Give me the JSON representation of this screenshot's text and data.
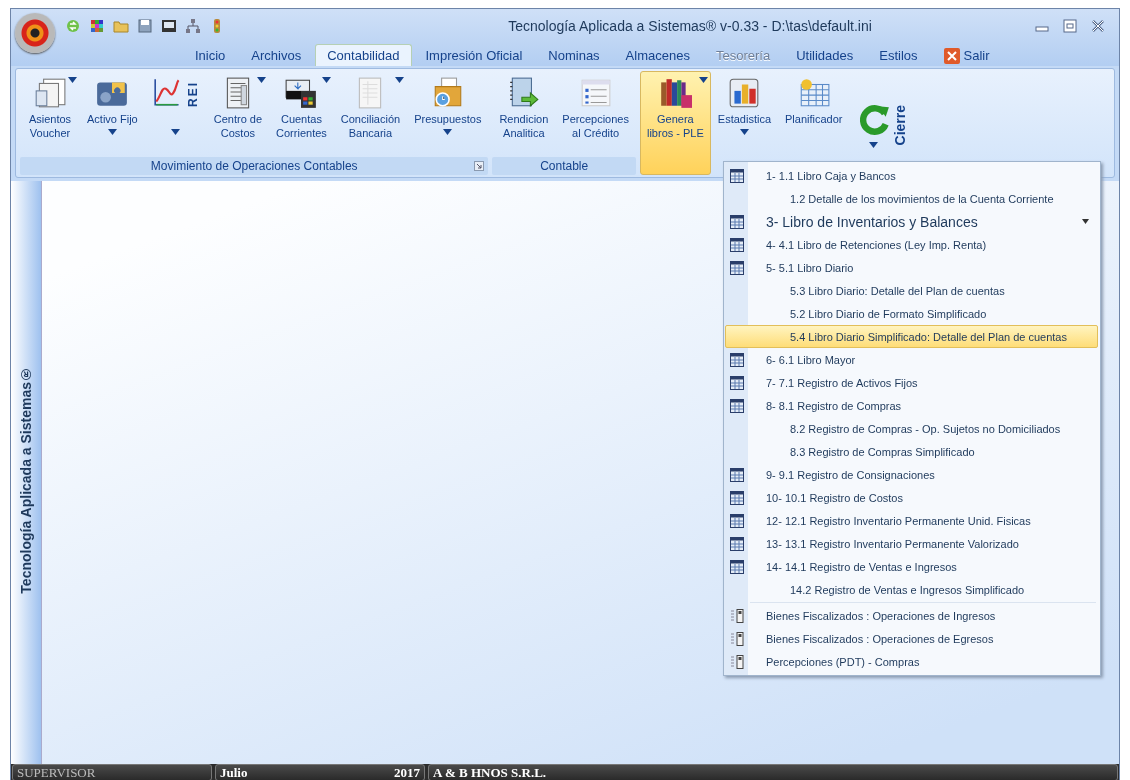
{
  "window": {
    "title": "Tecnología Aplicada a Sistemas® v-0.33 - D:\\tas\\default.ini"
  },
  "menu_tabs": [
    {
      "label": "Inicio",
      "selected": false,
      "disabled": false,
      "kind": "tab"
    },
    {
      "label": "Archivos",
      "selected": false,
      "disabled": false,
      "kind": "tab"
    },
    {
      "label": "Contabilidad",
      "selected": true,
      "disabled": false,
      "kind": "tab"
    },
    {
      "label": "Impresión Oficial",
      "selected": false,
      "disabled": false,
      "kind": "tab"
    },
    {
      "label": "Nominas",
      "selected": false,
      "disabled": false,
      "kind": "tab"
    },
    {
      "label": "Almacenes",
      "selected": false,
      "disabled": false,
      "kind": "tab"
    },
    {
      "label": "Tesorería",
      "selected": false,
      "disabled": true,
      "kind": "tab"
    },
    {
      "label": "Utilidades",
      "selected": false,
      "disabled": false,
      "kind": "tab"
    },
    {
      "label": "Estilos",
      "selected": false,
      "disabled": false,
      "kind": "tab"
    },
    {
      "label": "Salir",
      "selected": false,
      "disabled": false,
      "kind": "exit"
    }
  ],
  "ribbon_groups": [
    {
      "title": "Movimiento  de Operaciones Contables",
      "launcher": true,
      "items": [
        {
          "kind": "large",
          "label": [
            "Asientos",
            "Voucher"
          ],
          "arrow_top": true,
          "arrow_bottom": false,
          "pressed": false
        },
        {
          "kind": "large",
          "label": [
            "Activo Fijo"
          ],
          "arrow_top": false,
          "arrow_bottom": true,
          "pressed": false
        },
        {
          "kind": "tagged",
          "tag": "REI",
          "arrow_top": false,
          "arrow_bottom": true,
          "pressed": false
        },
        {
          "kind": "large",
          "label": [
            "Centro de",
            "Costos"
          ],
          "arrow_top": true,
          "arrow_bottom": false,
          "pressed": false
        },
        {
          "kind": "large",
          "label": [
            "Cuentas",
            "Corrientes"
          ],
          "arrow_top": true,
          "arrow_bottom": false,
          "pressed": false
        },
        {
          "kind": "large",
          "label": [
            "Conciliación",
            "Bancaria"
          ],
          "arrow_top": true,
          "arrow_bottom": false,
          "pressed": false
        },
        {
          "kind": "large",
          "label": [
            "Presupuestos"
          ],
          "arrow_top": false,
          "arrow_bottom": true,
          "pressed": false
        }
      ]
    },
    {
      "title": "Contable",
      "items": [
        {
          "kind": "large",
          "label": [
            "Rendicion",
            "Analitica"
          ],
          "arrow_top": false,
          "arrow_bottom": false,
          "pressed": false
        },
        {
          "kind": "large",
          "label": [
            "Percepciones",
            "al Crédito"
          ],
          "arrow_top": false,
          "arrow_bottom": false,
          "pressed": false
        }
      ]
    },
    {
      "items": [
        {
          "kind": "large",
          "label": [
            "Genera",
            "libros - PLE"
          ],
          "arrow_top": true,
          "arrow_bottom": false,
          "pressed": true
        },
        {
          "kind": "large",
          "label": [
            "Estadistica"
          ],
          "arrow_top": false,
          "arrow_bottom": true,
          "pressed": false
        },
        {
          "kind": "large",
          "label": [
            "Planificador"
          ],
          "arrow_top": false,
          "arrow_bottom": false,
          "pressed": false
        },
        {
          "kind": "vertical",
          "label": [
            "Cierre"
          ],
          "arrow_top": false,
          "arrow_bottom": true,
          "pressed": false
        }
      ]
    }
  ],
  "side_banner": "Tecnología Aplicada a Sistemas®",
  "dropdown_menu": {
    "sections": [
      {
        "items": [
          {
            "kind": "book",
            "label": "1- 1.1 Libro Caja y Bancos",
            "selected": false,
            "submenu": false
          },
          {
            "kind": "plain",
            "label": "1.2 Detalle de los movimientos  de la Cuenta Corriente",
            "selected": false,
            "submenu": false
          },
          {
            "kind": "book",
            "label": "3-  Libro de Inventarios y Balances",
            "selected": false,
            "submenu": true
          },
          {
            "kind": "book",
            "label": "4-  4.1 Libro de Retenciones (Ley Imp. Renta)",
            "selected": false,
            "submenu": false
          },
          {
            "kind": "book",
            "label": "5-  5.1 Libro  Diario",
            "selected": false,
            "submenu": false
          },
          {
            "kind": "plain",
            "label": "5.3 Libro Diario: Detalle del Plan de cuentas",
            "selected": false,
            "submenu": false
          },
          {
            "kind": "plain",
            "label": "5.2 Libro Diario de Formato Simplificado",
            "selected": false,
            "submenu": false
          },
          {
            "kind": "plain",
            "label": "5.4 Libro Diario Simplificado: Detalle del Plan de cuentas",
            "selected": true,
            "submenu": false
          },
          {
            "kind": "book",
            "label": "6-  6.1 Libro Mayor",
            "selected": false,
            "submenu": false
          },
          {
            "kind": "book",
            "label": "7-  7.1 Registro de Activos Fijos",
            "selected": false,
            "submenu": false
          },
          {
            "kind": "book",
            "label": "8-  8.1 Registro de Compras",
            "selected": false,
            "submenu": false
          },
          {
            "kind": "plain",
            "label": "8.2 Registro de Compras - Op. Sujetos no Domiciliados",
            "selected": false,
            "submenu": false
          },
          {
            "kind": "plain",
            "label": "8.3 Registro de Compras Simplificado",
            "selected": false,
            "submenu": false
          },
          {
            "kind": "book",
            "label": "9-  9.1 Registro de Consignaciones",
            "selected": false,
            "submenu": false
          },
          {
            "kind": "book",
            "label": "10- 10.1 Registro de Costos",
            "selected": false,
            "submenu": false
          },
          {
            "kind": "book",
            "label": "12- 12.1 Registro Inventario Permanente Unid. Fisicas",
            "selected": false,
            "submenu": false
          },
          {
            "kind": "book",
            "label": "13- 13.1 Registro  Inventario Permanente Valorizado",
            "selected": false,
            "submenu": false
          },
          {
            "kind": "book",
            "label": "14- 14.1 Registro de Ventas e Ingresos",
            "selected": false,
            "submenu": false
          },
          {
            "kind": "plain",
            "label": "14.2 Registro de Ventas e Ingresos Simplificado",
            "selected": false,
            "submenu": false
          }
        ]
      },
      {
        "items": [
          {
            "kind": "list",
            "label": "Bienes Fiscalizados : Operaciones de  Ingresos",
            "selected": false,
            "submenu": false
          },
          {
            "kind": "list",
            "label": "Bienes Fiscalizados : Operaciones de Egresos",
            "selected": false,
            "submenu": false
          },
          {
            "kind": "list",
            "label": "Percepciones (PDT) - Compras",
            "selected": false,
            "submenu": false
          }
        ]
      }
    ]
  },
  "status_bar": {
    "user": "SUPERVISOR",
    "month": "Julio",
    "year": "2017",
    "company": "A & B HNOS S.R.L."
  }
}
